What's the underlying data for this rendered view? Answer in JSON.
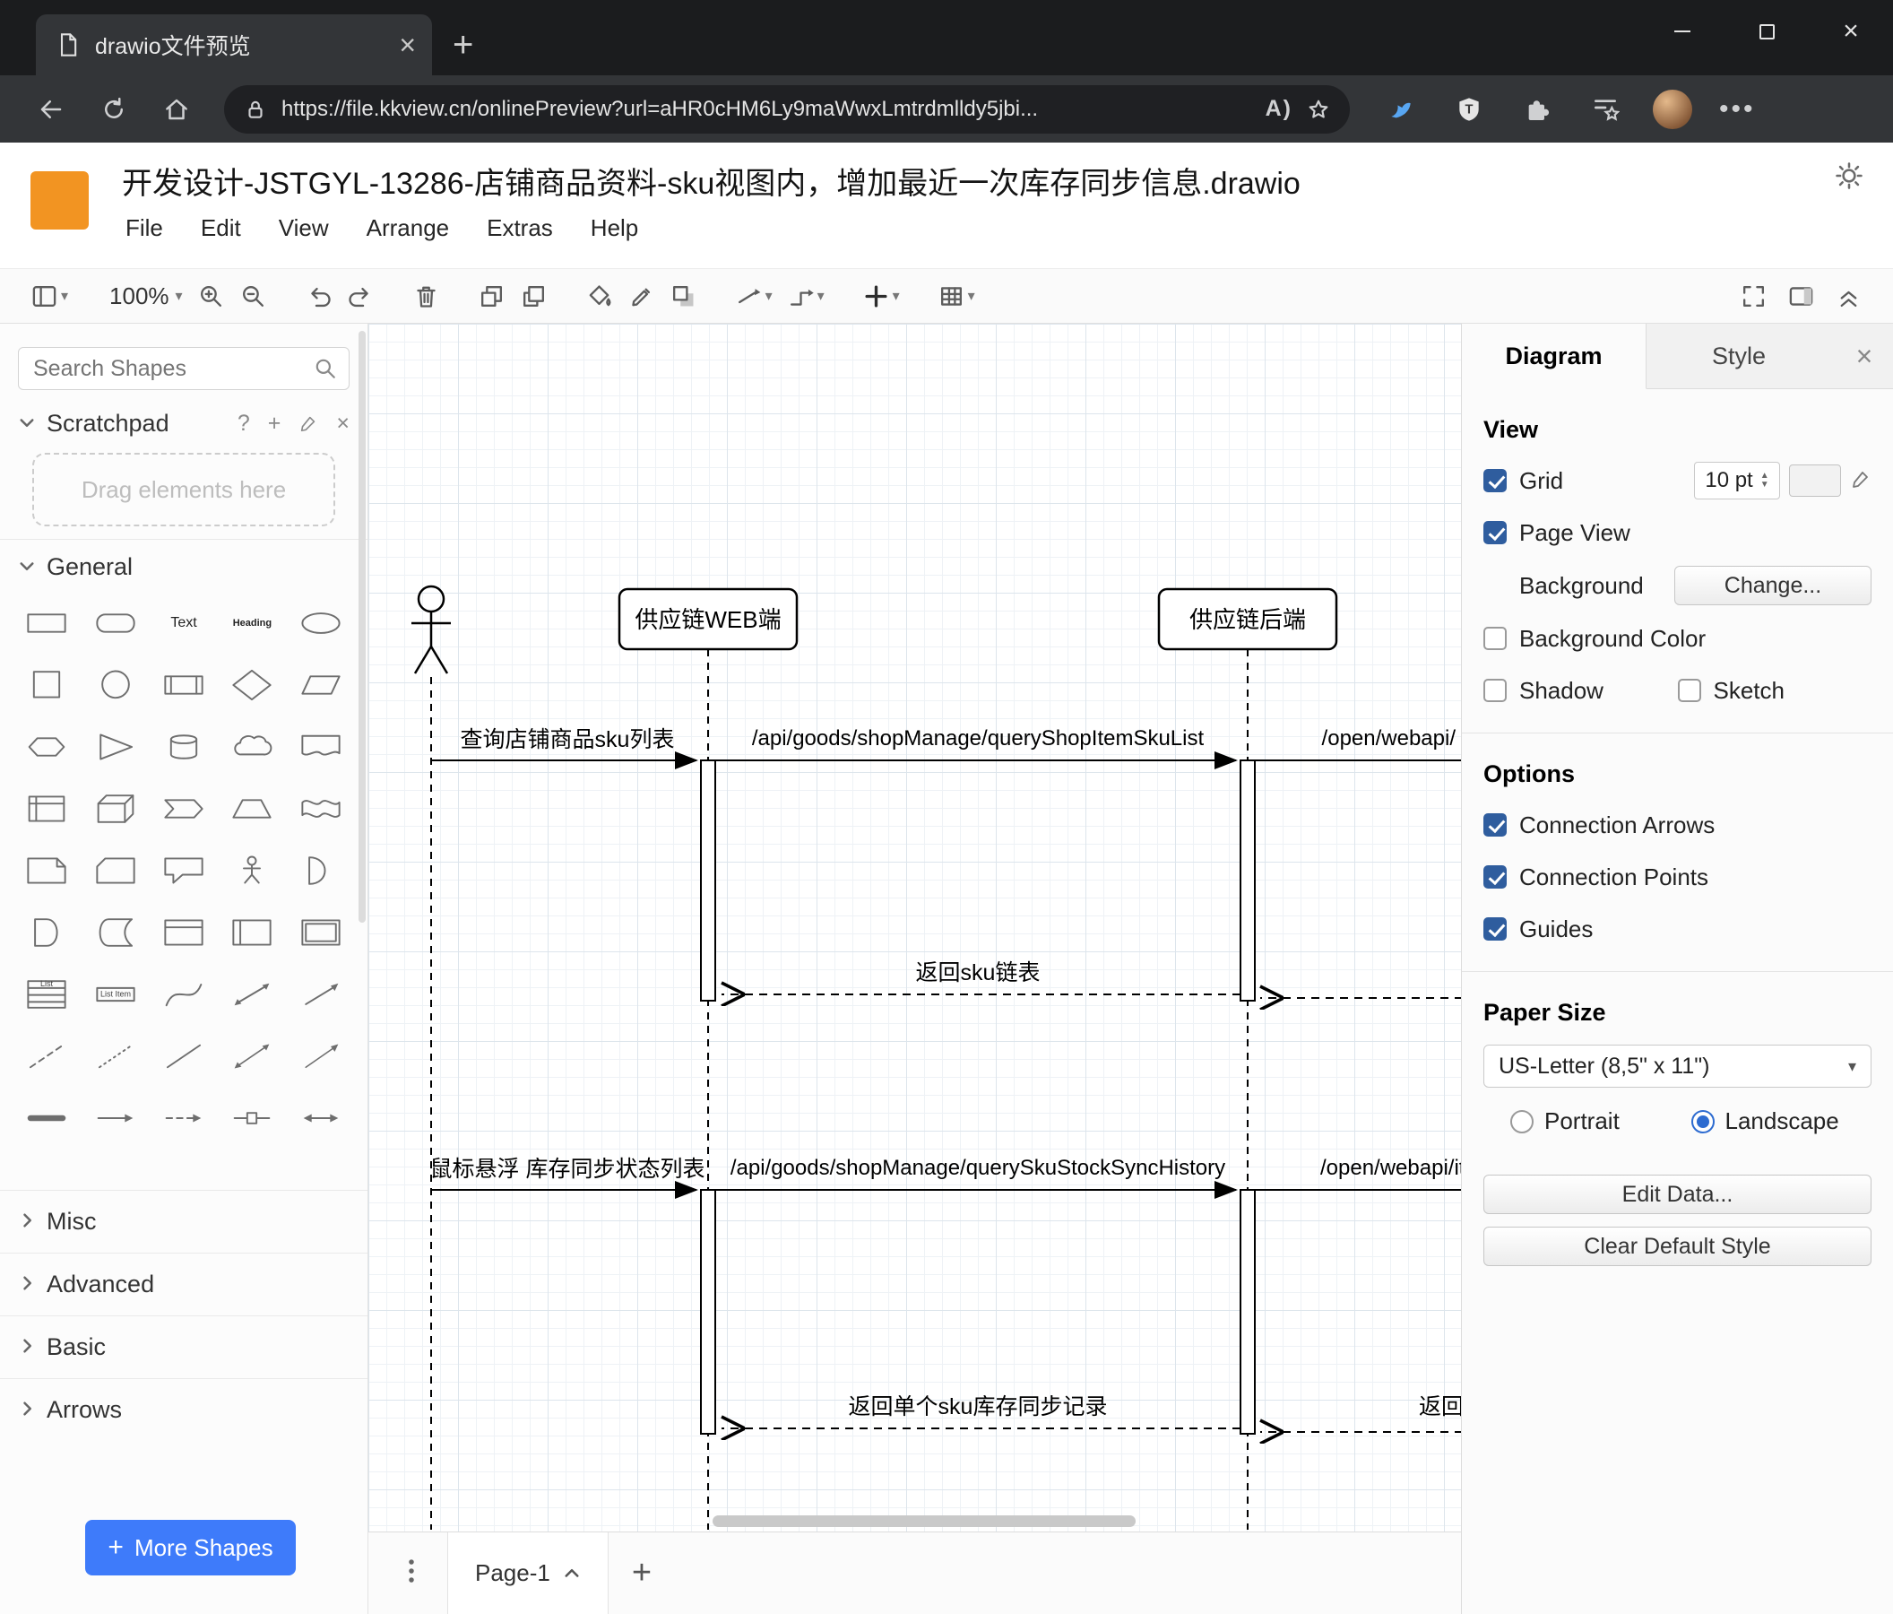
{
  "colors": {
    "logo_orange": "#F29422",
    "accent_blue": "#2d6bd0",
    "more_shapes_blue": "#3E7BFA"
  },
  "browser": {
    "tab_title": "drawio文件预览",
    "url": "https://file.kkview.cn/onlinePreview?url=aHR0cHM6Ly9maWwxLmtrdmlldy5jbi..."
  },
  "header": {
    "title": "开发设计-JSTGYL-13286-店铺商品资料-sku视图内，增加最近一次库存同步信息.drawio",
    "menus": [
      "File",
      "Edit",
      "View",
      "Arrange",
      "Extras",
      "Help"
    ]
  },
  "toolbar": {
    "zoom": "100%"
  },
  "sidebar": {
    "search_placeholder": "Search Shapes",
    "scratchpad_title": "Scratchpad",
    "scratchpad_hint": "Drag elements here",
    "sections": [
      "General",
      "Misc",
      "Advanced",
      "Basic",
      "Arrows"
    ],
    "more_shapes_label": "More Shapes",
    "shape_labels": {
      "text": "Text",
      "heading": "Heading",
      "list": "List",
      "list_item": "List Item"
    }
  },
  "canvas": {
    "participants": [
      {
        "label": "供应链WEB端"
      },
      {
        "label": "供应链后端"
      }
    ],
    "messages": [
      {
        "label": "查询店铺商品sku列表"
      },
      {
        "label": "/api/goods/shopManage/queryShopItemSkuList"
      },
      {
        "label": "/open/webapi/"
      },
      {
        "label": "返回sku链表"
      },
      {
        "label": "鼠标悬浮 库存同步状态列表"
      },
      {
        "label": "/api/goods/shopManage/querySkuStockSyncHistory"
      },
      {
        "label": "/open/webapi/item"
      },
      {
        "label": "返回单个sku库存同步记录"
      },
      {
        "label": "返回"
      }
    ]
  },
  "footer": {
    "page_tab": "Page-1"
  },
  "format_panel": {
    "tabs": [
      {
        "label": "Diagram"
      },
      {
        "label": "Style"
      }
    ],
    "view": {
      "heading": "View",
      "grid_label": "Grid",
      "grid_size": "10 pt",
      "page_view_label": "Page View",
      "background_label": "Background",
      "change_button": "Change...",
      "background_color_label": "Background Color",
      "shadow_label": "Shadow",
      "sketch_label": "Sketch"
    },
    "options": {
      "heading": "Options",
      "items": [
        "Connection Arrows",
        "Connection Points",
        "Guides"
      ]
    },
    "paper": {
      "heading": "Paper Size",
      "size_value": "US-Letter (8,5\" x 11\")",
      "portrait_label": "Portrait",
      "landscape_label": "Landscape"
    },
    "buttons": {
      "edit_data": "Edit Data...",
      "clear_default": "Clear Default Style"
    }
  }
}
